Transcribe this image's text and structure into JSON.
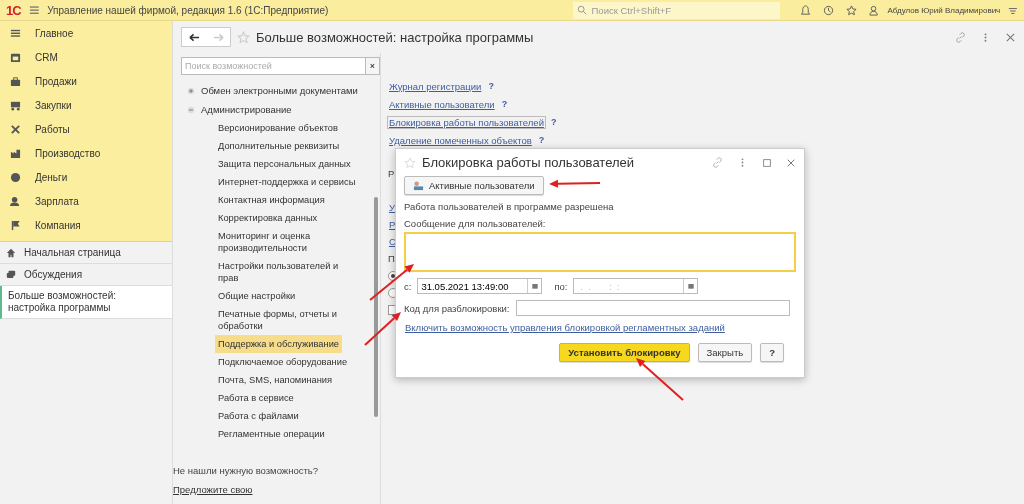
{
  "app": {
    "logo": "1С",
    "title": "Управление нашей фирмой, редакция 1.6  (1С:Предприятие)",
    "search_placeholder": "Поиск Ctrl+Shift+F",
    "user": "Абдулов Юрий Владимирович"
  },
  "sidebar": {
    "sections": [
      {
        "label": "Главное"
      },
      {
        "label": "CRM"
      },
      {
        "label": "Продажи"
      },
      {
        "label": "Закупки"
      },
      {
        "label": "Работы"
      },
      {
        "label": "Производство"
      },
      {
        "label": "Деньги"
      },
      {
        "label": "Зарплата"
      },
      {
        "label": "Компания"
      }
    ],
    "links": [
      {
        "label": "Начальная страница"
      },
      {
        "label": "Обсуждения"
      }
    ],
    "open_pages": [
      {
        "label": "Больше возможностей: настройка программы",
        "selected": true
      }
    ]
  },
  "page": {
    "title": "Больше возможностей: настройка программы",
    "search_placeholder": "Поиск возможностей",
    "clear": "×",
    "tree": [
      {
        "label": "Обмен электронными документами",
        "expanded": false
      },
      {
        "label": "Администрирование",
        "expanded": true,
        "children": [
          {
            "label": "Версионирование объектов",
            "selected": false
          },
          {
            "label": "Дополнительные реквизиты",
            "selected": false
          },
          {
            "label": "Защита персональных данных",
            "selected": false
          },
          {
            "label": "Интернет-поддержка и сервисы",
            "selected": false
          },
          {
            "label": "Контактная информация",
            "selected": false
          },
          {
            "label": "Корректировка данных",
            "selected": false
          },
          {
            "label": "Мониторинг и оценка производительности",
            "selected": false
          },
          {
            "label": "Настройки пользователей и прав",
            "selected": false
          },
          {
            "label": "Общие настройки",
            "selected": false
          },
          {
            "label": "Печатные формы, отчеты и обработки",
            "selected": false
          },
          {
            "label": "Поддержка и обслуживание",
            "selected": true
          },
          {
            "label": "Подключаемое оборудование",
            "selected": false
          },
          {
            "label": "Почта, SMS, напоминания",
            "selected": false
          },
          {
            "label": "Работа в сервисе",
            "selected": false
          },
          {
            "label": "Работа с файлами",
            "selected": false
          },
          {
            "label": "Регламентные операции",
            "selected": false
          }
        ]
      }
    ],
    "footer_question": "Не нашли нужную возможность?",
    "footer_link": "Предложите свою",
    "links": [
      {
        "label": "Журнал регистрации",
        "help": "?",
        "selected": false
      },
      {
        "label": "Активные пользователи",
        "help": "?",
        "selected": false
      },
      {
        "label": "Блокировка работы пользователей",
        "help": "?",
        "selected": true
      },
      {
        "label": "Удаление помеченных объектов",
        "help": "?",
        "selected": false
      }
    ],
    "hidden": [
      {
        "kind": "label",
        "text": "Р"
      },
      {
        "kind": "link",
        "text": "У"
      },
      {
        "kind": "link",
        "text": "Р"
      },
      {
        "kind": "link",
        "text": "С"
      },
      {
        "kind": "label",
        "text": "П"
      },
      {
        "kind": "radio",
        "selected": true
      },
      {
        "kind": "radio",
        "selected": false
      },
      {
        "kind": "checkbox",
        "checked": false
      }
    ]
  },
  "dialog": {
    "title": "Блокировка работы пользователей",
    "users_button": "Активные пользователи",
    "status": "Работа пользователей в программе разрешена",
    "message_label": "Сообщение для пользователей:",
    "from_label": "с:",
    "from_value": "31.05.2021 13:49:00",
    "to_label": "по:",
    "to_value": " .  .       :  :",
    "code_label": "Код для разблокировки:",
    "jobs_link": "Включить возможность управления блокировкой регламентных заданий",
    "set_button": "Установить блокировку",
    "close_button": "Закрыть",
    "help_button": "?"
  }
}
